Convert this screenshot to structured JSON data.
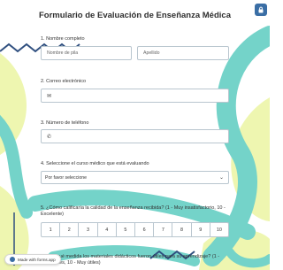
{
  "form": {
    "title": "Formulario de Evaluación de Enseñanza Médica",
    "q1": {
      "label": "1. Nombre completo",
      "first_placeholder": "Nombre de pila",
      "last_placeholder": "Apellido"
    },
    "q2": {
      "label": "2. Correo electrónico",
      "icon": "mail-icon"
    },
    "q3": {
      "label": "3. Número de teléfono",
      "icon": "phone-icon"
    },
    "q4": {
      "label": "4. Seleccione el curso médico que está evaluando",
      "selected": "Por favor seleccione"
    },
    "q5": {
      "label": "5. ¿Cómo calificaría la calidad de la enseñanza recibida? (1 - Muy insatisfactorio, 10 - Excelente)",
      "scale": [
        "1",
        "2",
        "3",
        "4",
        "5",
        "6",
        "7",
        "8",
        "9",
        "10"
      ]
    },
    "q6": {
      "label": "6. ¿En qué medida los materiales didácticos fueron útiles para su aprendizaje? (1 - Poco útiles, 10 - Muy útiles)"
    }
  },
  "badge": {
    "text": "Made with forms.app"
  },
  "colors": {
    "accent": "#3a6ea5",
    "teal": "#6fd1c8",
    "yellow": "#eef5a6",
    "navy": "#2f4f7f"
  }
}
